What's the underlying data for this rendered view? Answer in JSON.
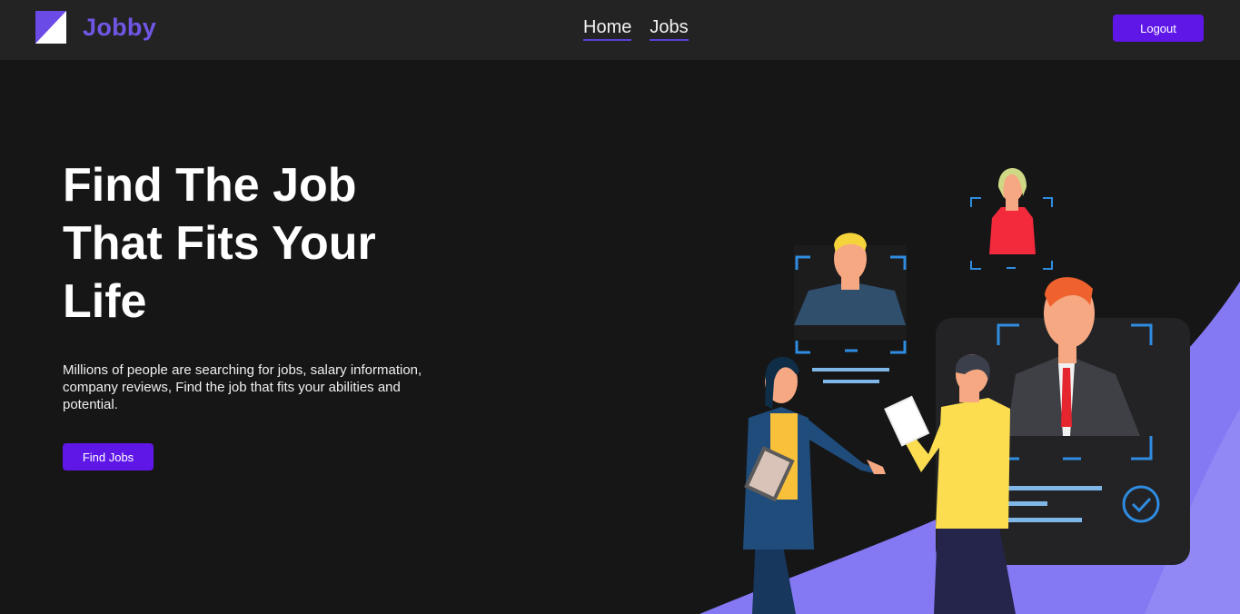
{
  "brand": {
    "name": "Jobby",
    "accent_color": "#7156e6"
  },
  "nav": {
    "links": [
      {
        "label": "Home"
      },
      {
        "label": "Jobs"
      }
    ],
    "logout_label": "Logout"
  },
  "hero": {
    "title": "Find The Job That Fits Your Life",
    "description": "Millions of people are searching for jobs, salary information, company reviews, Find the job that fits your abilities and potential.",
    "cta_label": "Find Jobs"
  },
  "colors": {
    "button": "#5f17e8",
    "background": "#161617",
    "navbar": "#232324",
    "wave": "#8479f3"
  },
  "illustration": {
    "icon": "job-recruitment-illustration",
    "check_icon": "check-circle-icon"
  }
}
